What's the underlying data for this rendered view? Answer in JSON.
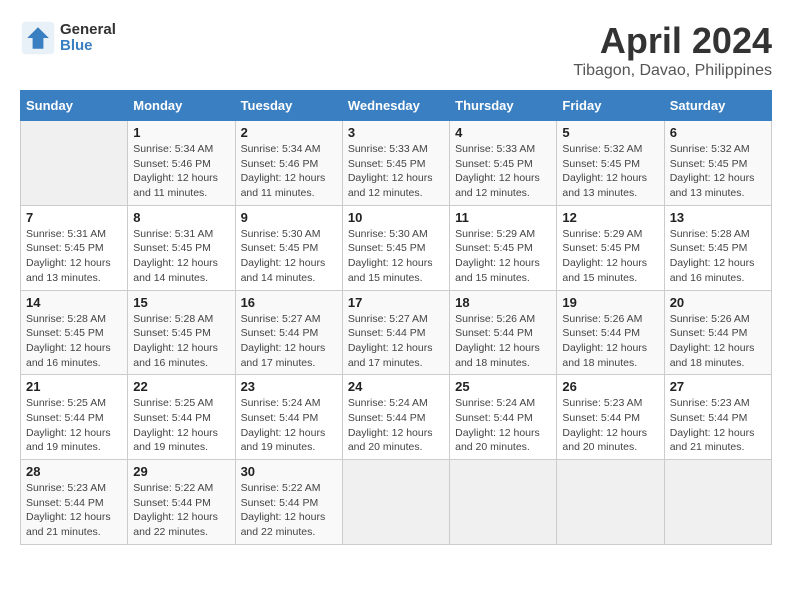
{
  "header": {
    "logo_line1": "General",
    "logo_line2": "Blue",
    "month": "April 2024",
    "location": "Tibagon, Davao, Philippines"
  },
  "weekdays": [
    "Sunday",
    "Monday",
    "Tuesday",
    "Wednesday",
    "Thursday",
    "Friday",
    "Saturday"
  ],
  "weeks": [
    [
      {
        "day": "",
        "empty": true
      },
      {
        "day": "1",
        "sunrise": "5:34 AM",
        "sunset": "5:46 PM",
        "daylight": "12 hours and 11 minutes."
      },
      {
        "day": "2",
        "sunrise": "5:34 AM",
        "sunset": "5:46 PM",
        "daylight": "12 hours and 11 minutes."
      },
      {
        "day": "3",
        "sunrise": "5:33 AM",
        "sunset": "5:45 PM",
        "daylight": "12 hours and 12 minutes."
      },
      {
        "day": "4",
        "sunrise": "5:33 AM",
        "sunset": "5:45 PM",
        "daylight": "12 hours and 12 minutes."
      },
      {
        "day": "5",
        "sunrise": "5:32 AM",
        "sunset": "5:45 PM",
        "daylight": "12 hours and 13 minutes."
      },
      {
        "day": "6",
        "sunrise": "5:32 AM",
        "sunset": "5:45 PM",
        "daylight": "12 hours and 13 minutes."
      }
    ],
    [
      {
        "day": "7",
        "sunrise": "5:31 AM",
        "sunset": "5:45 PM",
        "daylight": "12 hours and 13 minutes."
      },
      {
        "day": "8",
        "sunrise": "5:31 AM",
        "sunset": "5:45 PM",
        "daylight": "12 hours and 14 minutes."
      },
      {
        "day": "9",
        "sunrise": "5:30 AM",
        "sunset": "5:45 PM",
        "daylight": "12 hours and 14 minutes."
      },
      {
        "day": "10",
        "sunrise": "5:30 AM",
        "sunset": "5:45 PM",
        "daylight": "12 hours and 15 minutes."
      },
      {
        "day": "11",
        "sunrise": "5:29 AM",
        "sunset": "5:45 PM",
        "daylight": "12 hours and 15 minutes."
      },
      {
        "day": "12",
        "sunrise": "5:29 AM",
        "sunset": "5:45 PM",
        "daylight": "12 hours and 15 minutes."
      },
      {
        "day": "13",
        "sunrise": "5:28 AM",
        "sunset": "5:45 PM",
        "daylight": "12 hours and 16 minutes."
      }
    ],
    [
      {
        "day": "14",
        "sunrise": "5:28 AM",
        "sunset": "5:45 PM",
        "daylight": "12 hours and 16 minutes."
      },
      {
        "day": "15",
        "sunrise": "5:28 AM",
        "sunset": "5:45 PM",
        "daylight": "12 hours and 16 minutes."
      },
      {
        "day": "16",
        "sunrise": "5:27 AM",
        "sunset": "5:44 PM",
        "daylight": "12 hours and 17 minutes."
      },
      {
        "day": "17",
        "sunrise": "5:27 AM",
        "sunset": "5:44 PM",
        "daylight": "12 hours and 17 minutes."
      },
      {
        "day": "18",
        "sunrise": "5:26 AM",
        "sunset": "5:44 PM",
        "daylight": "12 hours and 18 minutes."
      },
      {
        "day": "19",
        "sunrise": "5:26 AM",
        "sunset": "5:44 PM",
        "daylight": "12 hours and 18 minutes."
      },
      {
        "day": "20",
        "sunrise": "5:26 AM",
        "sunset": "5:44 PM",
        "daylight": "12 hours and 18 minutes."
      }
    ],
    [
      {
        "day": "21",
        "sunrise": "5:25 AM",
        "sunset": "5:44 PM",
        "daylight": "12 hours and 19 minutes."
      },
      {
        "day": "22",
        "sunrise": "5:25 AM",
        "sunset": "5:44 PM",
        "daylight": "12 hours and 19 minutes."
      },
      {
        "day": "23",
        "sunrise": "5:24 AM",
        "sunset": "5:44 PM",
        "daylight": "12 hours and 19 minutes."
      },
      {
        "day": "24",
        "sunrise": "5:24 AM",
        "sunset": "5:44 PM",
        "daylight": "12 hours and 20 minutes."
      },
      {
        "day": "25",
        "sunrise": "5:24 AM",
        "sunset": "5:44 PM",
        "daylight": "12 hours and 20 minutes."
      },
      {
        "day": "26",
        "sunrise": "5:23 AM",
        "sunset": "5:44 PM",
        "daylight": "12 hours and 20 minutes."
      },
      {
        "day": "27",
        "sunrise": "5:23 AM",
        "sunset": "5:44 PM",
        "daylight": "12 hours and 21 minutes."
      }
    ],
    [
      {
        "day": "28",
        "sunrise": "5:23 AM",
        "sunset": "5:44 PM",
        "daylight": "12 hours and 21 minutes."
      },
      {
        "day": "29",
        "sunrise": "5:22 AM",
        "sunset": "5:44 PM",
        "daylight": "12 hours and 22 minutes."
      },
      {
        "day": "30",
        "sunrise": "5:22 AM",
        "sunset": "5:44 PM",
        "daylight": "12 hours and 22 minutes."
      },
      {
        "day": "",
        "empty": true
      },
      {
        "day": "",
        "empty": true
      },
      {
        "day": "",
        "empty": true
      },
      {
        "day": "",
        "empty": true
      }
    ]
  ]
}
